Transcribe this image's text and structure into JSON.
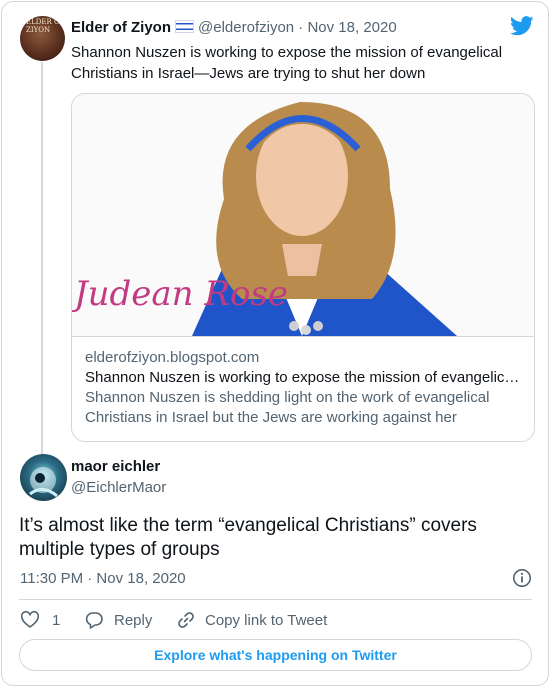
{
  "tweet1": {
    "display_name": "Elder of Ziyon",
    "flag_icon": "israel-flag-icon",
    "handle": "@elderofziyon",
    "separator": "·",
    "date": "Nov 18, 2020",
    "text": "Shannon Nuszen is working to expose the mission of evangelical Christians in Israel—Jews are trying to shut her down",
    "avatar_text": "ELDER OF ZIYON"
  },
  "link_card": {
    "image_brand": "Judean Rose",
    "domain": "elderofziyon.blogspot.com",
    "title": "Shannon Nuszen is working to expose the mission of evangelical Christians in Israel—Jews are trying to shut her down",
    "description": "Shannon Nuszen is shedding light on the work of evangelical Christians in Israel but the Jews are working against her"
  },
  "tweet2": {
    "display_name": "maor eichler",
    "handle": "@EichlerMaor",
    "text": "It’s almost like the term “evangelical Christians” covers multiple types of groups",
    "timestamp": "11:30 PM · Nov 18, 2020"
  },
  "actions": {
    "like_count": "1",
    "reply_label": "Reply",
    "copy_label": "Copy link to Tweet"
  },
  "explore_label": "Explore what's happening on Twitter",
  "colors": {
    "accent": "#1d9bf0",
    "secondary_text": "#536471",
    "border": "#cfd9de",
    "brand_pink": "#c23b82"
  }
}
